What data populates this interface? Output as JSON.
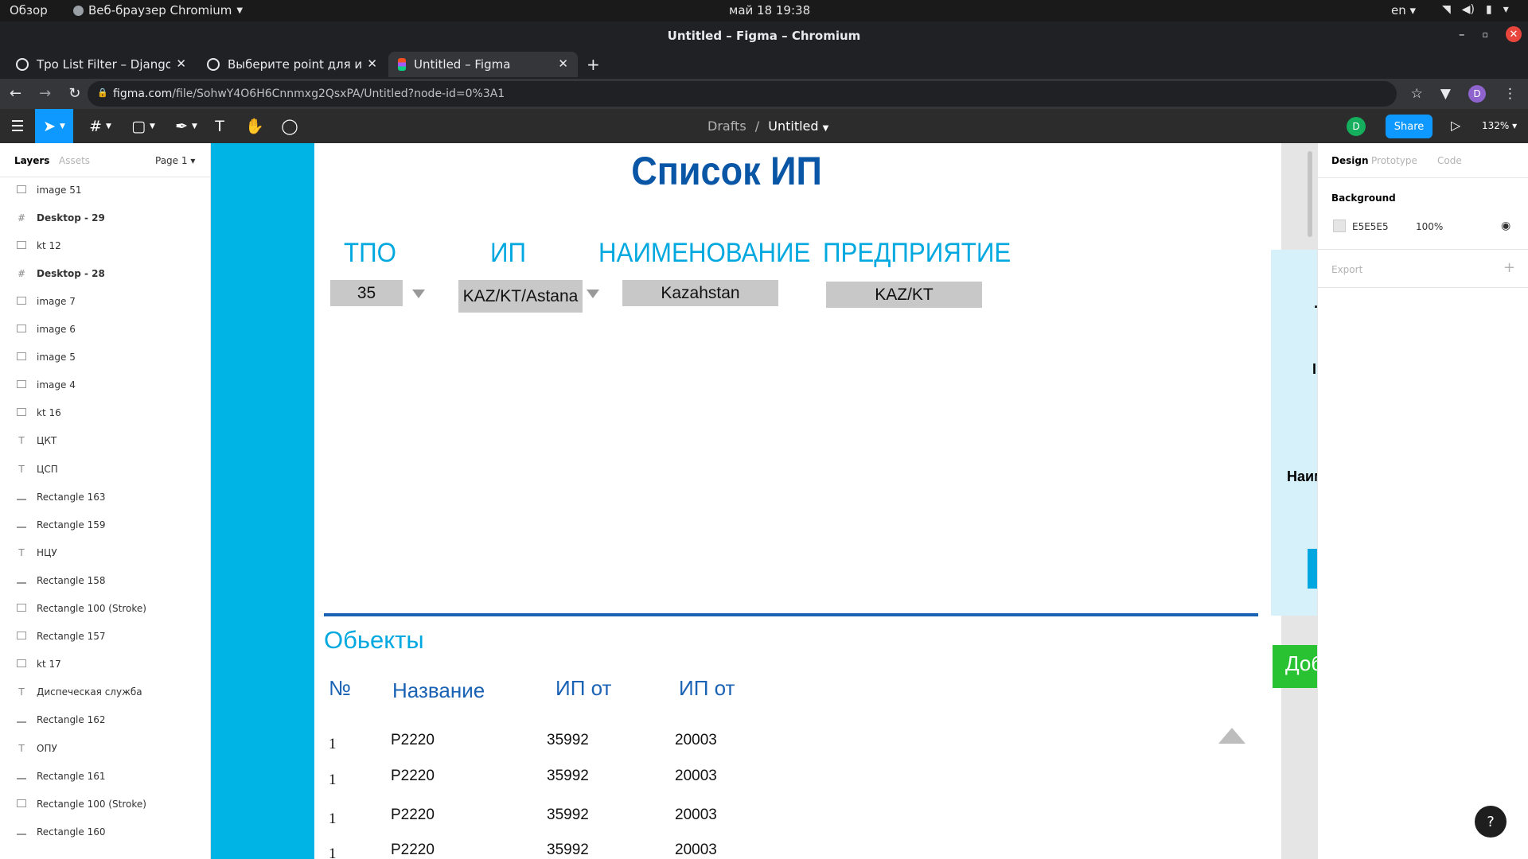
{
  "os": {
    "overview": "Обзор",
    "app_name": "Веб-браузер Chromium",
    "clock": "май 18  19:38",
    "lang": "en"
  },
  "window": {
    "title": "Untitled – Figma – Chromium"
  },
  "tabs": [
    {
      "label": "Tpo List Filter – Django RE"
    },
    {
      "label": "Выберите point для измен"
    },
    {
      "label": "Untitled – Figma"
    }
  ],
  "address": {
    "host": "figma.com",
    "path": "/file/SohwY4O6H6Cnnmxg2QsxPA/Untitled?node-id=0%3A1"
  },
  "figma": {
    "breadcrumb_drafts": "Drafts",
    "breadcrumb_sep": "/",
    "file_name": "Untitled",
    "user_initial": "D",
    "share_label": "Share",
    "zoom": "132%"
  },
  "left_panel": {
    "tab_layers": "Layers",
    "tab_assets": "Assets",
    "page": "Page 1",
    "layers": [
      {
        "label": "image 51",
        "type": "image"
      },
      {
        "label": "Desktop - 29",
        "type": "frame"
      },
      {
        "label": "kt 12",
        "type": "image"
      },
      {
        "label": "Desktop - 28",
        "type": "frame"
      },
      {
        "label": "image 7",
        "type": "image"
      },
      {
        "label": "image 6",
        "type": "image"
      },
      {
        "label": "image 5",
        "type": "image"
      },
      {
        "label": "image 4",
        "type": "image"
      },
      {
        "label": "kt 16",
        "type": "image"
      },
      {
        "label": "ЦКТ",
        "type": "text"
      },
      {
        "label": "ЦСП",
        "type": "text"
      },
      {
        "label": "Rectangle 163",
        "type": "line"
      },
      {
        "label": "Rectangle 159",
        "type": "line"
      },
      {
        "label": "НЦУ",
        "type": "text"
      },
      {
        "label": "Rectangle 158",
        "type": "line"
      },
      {
        "label": "Rectangle 100 (Stroke)",
        "type": "rect"
      },
      {
        "label": "Rectangle 157",
        "type": "rect"
      },
      {
        "label": "kt 17",
        "type": "image"
      },
      {
        "label": "Диспеческая служба",
        "type": "text"
      },
      {
        "label": "Rectangle 162",
        "type": "line"
      },
      {
        "label": "ОПУ",
        "type": "text"
      },
      {
        "label": "Rectangle 161",
        "type": "line"
      },
      {
        "label": "Rectangle 100 (Stroke)",
        "type": "rect"
      },
      {
        "label": "Rectangle 160",
        "type": "line"
      }
    ]
  },
  "canvas": {
    "title": "Список ИП",
    "filter_headers": {
      "tpo": "ТПО",
      "ip": "ИП",
      "name": "НАИМЕНОВАНИЕ",
      "enterprise": "ПРЕДПРИЯТИЕ"
    },
    "filter_values": {
      "tpo": "35",
      "ip": "KAZ/KT/Astana",
      "name": "Kazahstan",
      "enterprise": "KAZ/KT"
    },
    "objects_title": "Обьекты",
    "table_headers": [
      "№",
      "Название",
      "ИП от",
      "ИП от"
    ],
    "rows": [
      [
        "1",
        "P2220",
        "35992",
        "20003"
      ],
      [
        "1",
        "P2220",
        "35992",
        "20003"
      ],
      [
        "1",
        "P2220",
        "35992",
        "20003"
      ],
      [
        "1",
        "P2220",
        "35992",
        "20003"
      ]
    ],
    "right_frame": {
      "naim": "Наим"
    },
    "add_button": "Доб"
  },
  "right_panel": {
    "tab_design": "Design",
    "tab_prototype": "Prototype",
    "tab_code": "Code",
    "background_title": "Background",
    "bg_hex": "E5E5E5",
    "bg_opacity": "100%",
    "export_title": "Export",
    "export_add": "+"
  },
  "help": "?"
}
